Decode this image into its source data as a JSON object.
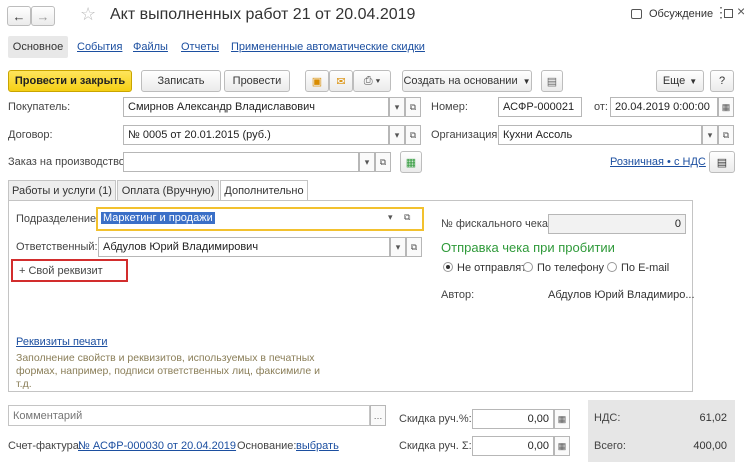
{
  "window": {
    "title": "Акт выполненных работ 21 от 20.04.2019",
    "discussion": "Обсуждение"
  },
  "nav_tabs": [
    "Основное",
    "События",
    "Файлы",
    "Отчеты",
    "Примененные автоматические скидки"
  ],
  "toolbar": {
    "post_close": "Провести и закрыть",
    "save": "Записать",
    "post": "Провести",
    "create_based_on": "Создать на основании",
    "more": "Еще"
  },
  "header_fields": {
    "buyer_label": "Покупатель:",
    "buyer_value": "Смирнов Александр Владиславович",
    "number_label": "Номер:",
    "number_value": "АСФР-000021",
    "date_label": "от:",
    "date_value": "20.04.2019  0:00:00",
    "contract_label": "Договор:",
    "contract_value": "№ 0005 от 20.01.2015 (руб.)",
    "org_label": "Организация:",
    "org_value": "Кухни Ассоль",
    "order_label": "Заказ на производство:",
    "order_value": "",
    "vat_link": "Розничная • с НДС"
  },
  "form_tabs": [
    "Работы и услуги (1)",
    "Оплата (Вручную)",
    "Дополнительно"
  ],
  "additional": {
    "division_label": "Подразделение:",
    "division_value": "Маркетинг и продажи",
    "responsible_label": "Ответственный:",
    "responsible_value": "Абдулов Юрий Владимирович",
    "own_attr": "+ Свой реквизит",
    "fiscal_label": "№ фискального чека:",
    "fiscal_value": "0",
    "send_receipt_title": "Отправка чека при пробитии",
    "radio_options": [
      "Не отправлять",
      "По телефону",
      "По E-mail"
    ],
    "author_label": "Автор:",
    "author_value": "Абдулов Юрий Владимиро...",
    "print_details_link": "Реквизиты печати",
    "print_details_hint": "Заполнение свойств и реквизитов, используемых в печатных формах, например, подписи ответственных лиц, факсимиле и т.д."
  },
  "footer": {
    "comment_placeholder": "Комментарий",
    "discount_pct_label": "Скидка руч.%:",
    "discount_pct_value": "0,00",
    "discount_sum_label": "Скидка руч. Σ:",
    "discount_sum_value": "0,00",
    "vat_label": "НДС:",
    "vat_value": "61,02",
    "total_label": "Всего:",
    "total_value": "400,00",
    "invoice_label": "Счет-фактура:",
    "invoice_link": "№ АСФР-000030  от 20.04.2019",
    "basis_label": "Основание:",
    "basis_link": "выбрать"
  },
  "colors": {
    "primary_button": "#f5cf14",
    "link": "#1c4fa0",
    "green_title": "#2f9a3a",
    "highlight_border": "#f2c12e",
    "selection": "#3a6fc7",
    "red_box": "#d22d2d"
  }
}
